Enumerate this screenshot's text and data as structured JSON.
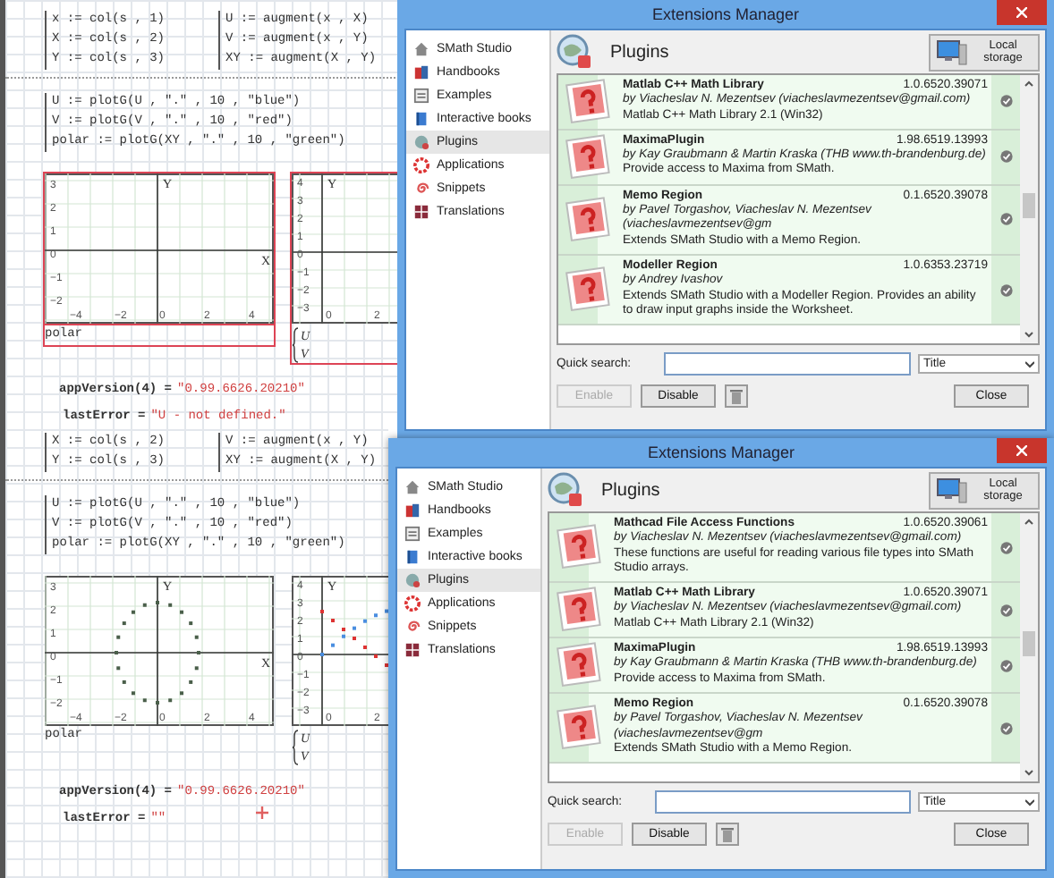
{
  "worksheets": [
    {
      "definitions": [
        [
          "x := col(s , 1)",
          "X := col(s , 2)",
          "Y := col(s , 3)"
        ],
        [
          "U := augment(x , X)",
          "V := augment(x , Y)",
          "XY := augment(X , Y)"
        ]
      ],
      "plot_commands": [
        "U := plotG(U , \".\" , 10 , \"blue\")",
        "V := plotG(V , \".\" , 10 , \"red\")",
        "polar := plotG(XY , \".\" , 10 , \"green\")"
      ],
      "plots": [
        {
          "kind": "cartesian",
          "selected": true,
          "plotted": false,
          "x_axis": "X",
          "y_axis": "Y",
          "x_ticks": [
            "−4",
            "−2",
            "0",
            "2",
            "4"
          ],
          "y_ticks": [
            "3",
            "2",
            "1",
            "0",
            "−1",
            "−2"
          ],
          "caption": "polar"
        },
        {
          "kind": "curves",
          "selected": true,
          "plotted": false,
          "y_axis": "Y",
          "x_ticks": [
            "0",
            "2"
          ],
          "y_ticks": [
            "4",
            "3",
            "2",
            "1",
            "0",
            "−1",
            "−2",
            "−3"
          ],
          "legend": [
            "U",
            "V"
          ]
        }
      ],
      "outputs": [
        {
          "expression": "appVersion(4) =",
          "result": "\"0.99.6626.20210\""
        },
        {
          "expression": "lastError =",
          "result": "\"U - not defined.\""
        }
      ],
      "cursor": false
    },
    {
      "definitions": [
        [
          "X := col(s , 2)",
          "Y := col(s , 3)"
        ],
        [
          "V := augment(x , Y)",
          "XY := augment(X , Y)"
        ]
      ],
      "plot_commands": [
        "U := plotG(U , \".\" , 10 , \"blue\")",
        "V := plotG(V , \".\" , 10 , \"red\")",
        "polar := plotG(XY , \".\" , 10 , \"green\")"
      ],
      "plots": [
        {
          "kind": "cartesian",
          "selected": false,
          "plotted": true,
          "x_axis": "X",
          "y_axis": "Y",
          "x_ticks": [
            "−4",
            "−2",
            "0",
            "2",
            "4"
          ],
          "y_ticks": [
            "3",
            "2",
            "1",
            "0",
            "−1",
            "−2"
          ],
          "caption": "polar"
        },
        {
          "kind": "curves",
          "selected": false,
          "plotted": true,
          "y_axis": "Y",
          "x_ticks": [
            "0",
            "2"
          ],
          "y_ticks": [
            "4",
            "3",
            "2",
            "1",
            "0",
            "−1",
            "−2",
            "−3"
          ],
          "legend": [
            "U",
            "V"
          ]
        }
      ],
      "outputs": [
        {
          "expression": "appVersion(4) =",
          "result": "\"0.99.6626.20210\""
        },
        {
          "expression": "lastError =",
          "result": "\"\""
        }
      ],
      "cursor": true
    }
  ],
  "windows": [
    {
      "title": "Extensions Manager",
      "sidebar": [
        {
          "label": "SMath Studio",
          "selected": false
        },
        {
          "label": "Handbooks",
          "selected": false
        },
        {
          "label": "Examples",
          "selected": false
        },
        {
          "label": "Interactive books",
          "selected": false
        },
        {
          "label": "Plugins",
          "selected": true
        },
        {
          "label": "Applications",
          "selected": false
        },
        {
          "label": "Snippets",
          "selected": false
        },
        {
          "label": "Translations",
          "selected": false
        }
      ],
      "section": "Plugins",
      "storage_button": "Local storage",
      "plugins": [
        {
          "name": "Matlab C++ Math Library",
          "version": "1.0.6520.39071",
          "author": "by Viacheslav N. Mezentsev (viacheslavmezentsev@gmail.com)",
          "description": "Matlab C++ Math Library 2.1 (Win32)"
        },
        {
          "name": "MaximaPlugin",
          "version": "1.98.6519.13993",
          "author": "by Kay Graubmann & Martin Kraska (THB www.th-brandenburg.de)",
          "description": "Provide access to Maxima from SMath."
        },
        {
          "name": "Memo Region",
          "version": "0.1.6520.39078",
          "author": "by Pavel Torgashov, Viacheslav N. Mezentsev (viacheslavmezentsev@gm",
          "description": "Extends SMath Studio with a Memo Region."
        },
        {
          "name": "Modeller Region",
          "version": "1.0.6353.23719",
          "author": "by Andrey Ivashov",
          "description": "Extends SMath Studio with a Modeller Region. Provides an ability to draw input graphs inside the Worksheet."
        }
      ],
      "search_label": "Quick search:",
      "search_scope": "Title",
      "buttons": [
        {
          "kind": "text",
          "label": "Enable",
          "disabled": true
        },
        {
          "kind": "text",
          "label": "Disable",
          "disabled": false
        },
        {
          "kind": "trash"
        },
        {
          "kind": "text",
          "label": "Close",
          "disabled": false
        }
      ]
    },
    {
      "title": "Extensions Manager",
      "sidebar": [
        {
          "label": "SMath Studio",
          "selected": false
        },
        {
          "label": "Handbooks",
          "selected": false
        },
        {
          "label": "Examples",
          "selected": false
        },
        {
          "label": "Interactive books",
          "selected": false
        },
        {
          "label": "Plugins",
          "selected": true
        },
        {
          "label": "Applications",
          "selected": false
        },
        {
          "label": "Snippets",
          "selected": false
        },
        {
          "label": "Translations",
          "selected": false
        }
      ],
      "section": "Plugins",
      "storage_button": "Local storage",
      "plugins": [
        {
          "name": "Mathcad File Access Functions",
          "version": "1.0.6520.39061",
          "author": "by Viacheslav N. Mezentsev (viacheslavmezentsev@gmail.com)",
          "description": "These functions are useful for reading various file types into SMath Studio arrays."
        },
        {
          "name": "Matlab C++ Math Library",
          "version": "1.0.6520.39071",
          "author": "by Viacheslav N. Mezentsev (viacheslavmezentsev@gmail.com)",
          "description": "Matlab C++ Math Library 2.1 (Win32)"
        },
        {
          "name": "MaximaPlugin",
          "version": "1.98.6519.13993",
          "author": "by Kay Graubmann & Martin Kraska (THB www.th-brandenburg.de)",
          "description": "Provide access to Maxima from SMath."
        },
        {
          "name": "Memo Region",
          "version": "0.1.6520.39078",
          "author": "by Pavel Torgashov, Viacheslav N. Mezentsev (viacheslavmezentsev@gm",
          "description": "Extends SMath Studio with a Memo Region."
        }
      ],
      "search_label": "Quick search:",
      "search_scope": "Title",
      "buttons": [
        {
          "kind": "text",
          "label": "Enable",
          "disabled": true
        },
        {
          "kind": "text",
          "label": "Disable",
          "disabled": false
        },
        {
          "kind": "trash"
        },
        {
          "kind": "text",
          "label": "Close",
          "disabled": false
        }
      ]
    }
  ]
}
